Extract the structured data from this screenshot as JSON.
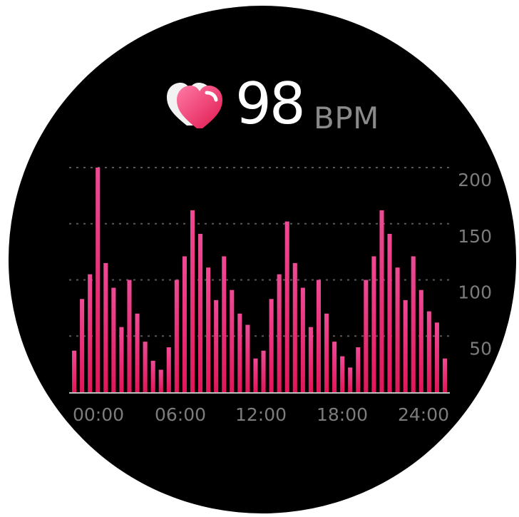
{
  "header": {
    "bpm_value": "98",
    "bpm_unit": "BPM",
    "icon": "heart-icon"
  },
  "colors": {
    "background": "#000000",
    "bar_top": "#ee4a95",
    "bar_bottom": "#e2165a",
    "grid": "#5a5a5a",
    "tick_text": "#7c7c7c",
    "bpm_text": "#ffffff",
    "unit_text": "#8a8a8a"
  },
  "chart_data": {
    "type": "bar",
    "title": "",
    "xlabel": "",
    "ylabel": "",
    "ylim": [
      0,
      200
    ],
    "y_ticks": [
      "200",
      "150",
      "100",
      "50"
    ],
    "x_ticks": [
      "00:00",
      "06:00",
      "12:00",
      "18:00",
      "24:00"
    ],
    "grid": true,
    "series": [
      {
        "values": [
          37,
          83,
          105,
          200,
          115,
          93,
          58,
          100,
          70,
          45,
          28,
          20,
          40,
          100,
          121,
          162,
          141,
          111,
          82,
          121,
          91,
          70,
          60,
          30,
          37,
          83,
          105,
          152,
          115,
          93,
          58,
          100,
          70,
          45,
          32,
          22,
          40,
          100,
          121,
          162,
          141,
          111,
          82,
          121,
          91,
          72,
          62,
          30
        ]
      }
    ]
  }
}
